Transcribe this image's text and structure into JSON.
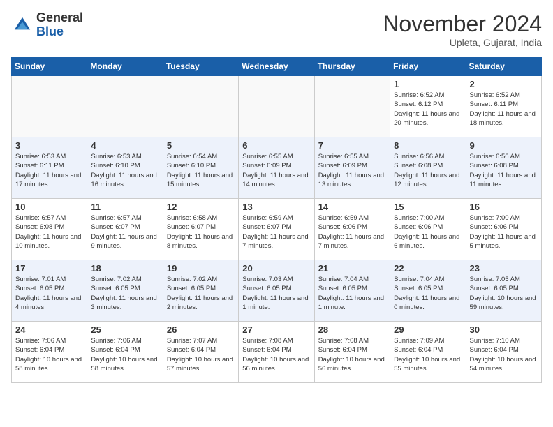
{
  "header": {
    "logo_general": "General",
    "logo_blue": "Blue",
    "month": "November 2024",
    "location": "Upleta, Gujarat, India"
  },
  "days_of_week": [
    "Sunday",
    "Monday",
    "Tuesday",
    "Wednesday",
    "Thursday",
    "Friday",
    "Saturday"
  ],
  "weeks": [
    [
      {
        "day": "",
        "info": ""
      },
      {
        "day": "",
        "info": ""
      },
      {
        "day": "",
        "info": ""
      },
      {
        "day": "",
        "info": ""
      },
      {
        "day": "",
        "info": ""
      },
      {
        "day": "1",
        "info": "Sunrise: 6:52 AM\nSunset: 6:12 PM\nDaylight: 11 hours and 20 minutes."
      },
      {
        "day": "2",
        "info": "Sunrise: 6:52 AM\nSunset: 6:11 PM\nDaylight: 11 hours and 18 minutes."
      }
    ],
    [
      {
        "day": "3",
        "info": "Sunrise: 6:53 AM\nSunset: 6:11 PM\nDaylight: 11 hours and 17 minutes."
      },
      {
        "day": "4",
        "info": "Sunrise: 6:53 AM\nSunset: 6:10 PM\nDaylight: 11 hours and 16 minutes."
      },
      {
        "day": "5",
        "info": "Sunrise: 6:54 AM\nSunset: 6:10 PM\nDaylight: 11 hours and 15 minutes."
      },
      {
        "day": "6",
        "info": "Sunrise: 6:55 AM\nSunset: 6:09 PM\nDaylight: 11 hours and 14 minutes."
      },
      {
        "day": "7",
        "info": "Sunrise: 6:55 AM\nSunset: 6:09 PM\nDaylight: 11 hours and 13 minutes."
      },
      {
        "day": "8",
        "info": "Sunrise: 6:56 AM\nSunset: 6:08 PM\nDaylight: 11 hours and 12 minutes."
      },
      {
        "day": "9",
        "info": "Sunrise: 6:56 AM\nSunset: 6:08 PM\nDaylight: 11 hours and 11 minutes."
      }
    ],
    [
      {
        "day": "10",
        "info": "Sunrise: 6:57 AM\nSunset: 6:08 PM\nDaylight: 11 hours and 10 minutes."
      },
      {
        "day": "11",
        "info": "Sunrise: 6:57 AM\nSunset: 6:07 PM\nDaylight: 11 hours and 9 minutes."
      },
      {
        "day": "12",
        "info": "Sunrise: 6:58 AM\nSunset: 6:07 PM\nDaylight: 11 hours and 8 minutes."
      },
      {
        "day": "13",
        "info": "Sunrise: 6:59 AM\nSunset: 6:07 PM\nDaylight: 11 hours and 7 minutes."
      },
      {
        "day": "14",
        "info": "Sunrise: 6:59 AM\nSunset: 6:06 PM\nDaylight: 11 hours and 7 minutes."
      },
      {
        "day": "15",
        "info": "Sunrise: 7:00 AM\nSunset: 6:06 PM\nDaylight: 11 hours and 6 minutes."
      },
      {
        "day": "16",
        "info": "Sunrise: 7:00 AM\nSunset: 6:06 PM\nDaylight: 11 hours and 5 minutes."
      }
    ],
    [
      {
        "day": "17",
        "info": "Sunrise: 7:01 AM\nSunset: 6:05 PM\nDaylight: 11 hours and 4 minutes."
      },
      {
        "day": "18",
        "info": "Sunrise: 7:02 AM\nSunset: 6:05 PM\nDaylight: 11 hours and 3 minutes."
      },
      {
        "day": "19",
        "info": "Sunrise: 7:02 AM\nSunset: 6:05 PM\nDaylight: 11 hours and 2 minutes."
      },
      {
        "day": "20",
        "info": "Sunrise: 7:03 AM\nSunset: 6:05 PM\nDaylight: 11 hours and 1 minute."
      },
      {
        "day": "21",
        "info": "Sunrise: 7:04 AM\nSunset: 6:05 PM\nDaylight: 11 hours and 1 minute."
      },
      {
        "day": "22",
        "info": "Sunrise: 7:04 AM\nSunset: 6:05 PM\nDaylight: 11 hours and 0 minutes."
      },
      {
        "day": "23",
        "info": "Sunrise: 7:05 AM\nSunset: 6:05 PM\nDaylight: 10 hours and 59 minutes."
      }
    ],
    [
      {
        "day": "24",
        "info": "Sunrise: 7:06 AM\nSunset: 6:04 PM\nDaylight: 10 hours and 58 minutes."
      },
      {
        "day": "25",
        "info": "Sunrise: 7:06 AM\nSunset: 6:04 PM\nDaylight: 10 hours and 58 minutes."
      },
      {
        "day": "26",
        "info": "Sunrise: 7:07 AM\nSunset: 6:04 PM\nDaylight: 10 hours and 57 minutes."
      },
      {
        "day": "27",
        "info": "Sunrise: 7:08 AM\nSunset: 6:04 PM\nDaylight: 10 hours and 56 minutes."
      },
      {
        "day": "28",
        "info": "Sunrise: 7:08 AM\nSunset: 6:04 PM\nDaylight: 10 hours and 56 minutes."
      },
      {
        "day": "29",
        "info": "Sunrise: 7:09 AM\nSunset: 6:04 PM\nDaylight: 10 hours and 55 minutes."
      },
      {
        "day": "30",
        "info": "Sunrise: 7:10 AM\nSunset: 6:04 PM\nDaylight: 10 hours and 54 minutes."
      }
    ]
  ]
}
